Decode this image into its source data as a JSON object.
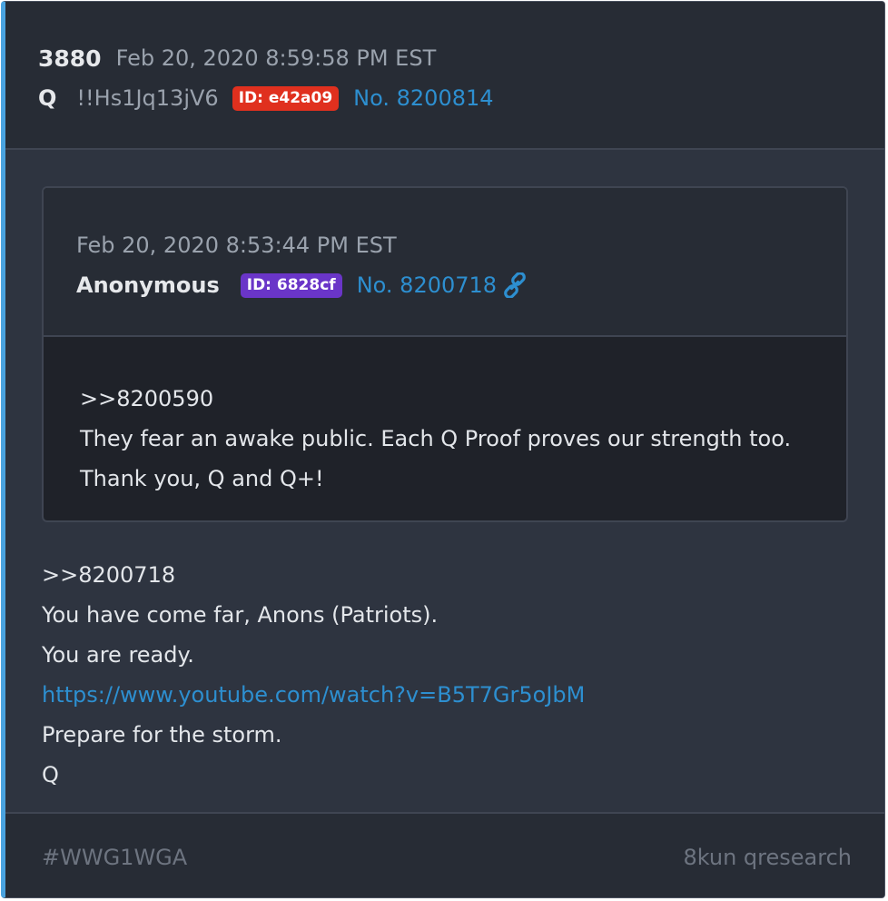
{
  "post": {
    "number": "3880",
    "timestamp": "Feb 20, 2020 8:59:58 PM EST",
    "author": "Q",
    "tripcode": "!!Hs1Jq13jV6",
    "id_badge": "ID: e42a09",
    "post_link": "No. 8200814"
  },
  "quoted": {
    "timestamp": "Feb 20, 2020 8:53:44 PM EST",
    "author": "Anonymous",
    "id_badge": "ID: 6828cf",
    "post_link": "No. 8200718",
    "lines": [
      ">>8200590",
      "They fear an awake public. Each Q Proof proves our strength too.",
      "Thank you, Q and Q+!"
    ]
  },
  "body": {
    "lines": [
      ">>8200718",
      "You have come far, Anons (Patriots).",
      "You are ready.",
      "https://www.youtube.com/watch?v=B5T7Gr5oJbM",
      "Prepare for the storm.",
      "Q"
    ]
  },
  "footer": {
    "hashtag": "#WWG1WGA",
    "source": "8kun qresearch"
  },
  "colors": {
    "accent_border": "#4aa3df",
    "link": "#2d8fd0",
    "badge_red": "#e0301e",
    "badge_purple": "#6a35c8"
  },
  "icons": {
    "quoted_link": "chain-link-icon"
  }
}
